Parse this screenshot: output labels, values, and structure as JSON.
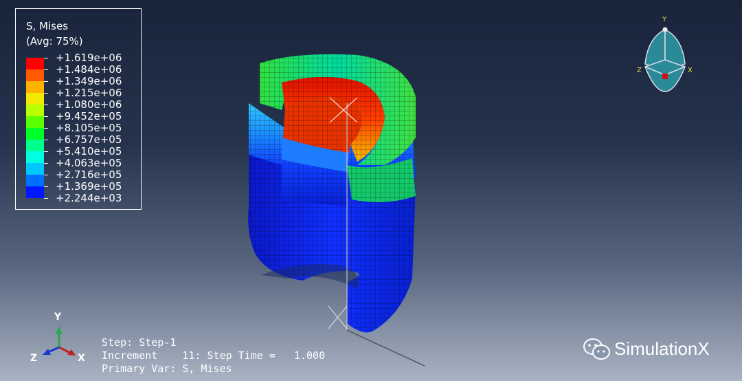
{
  "legend": {
    "title": "S, Mises",
    "subtitle": "(Avg: 75%)",
    "entries": [
      {
        "value": "+1.619e+06",
        "color": "#ff0000"
      },
      {
        "value": "+1.484e+06",
        "color": "#ff5a00"
      },
      {
        "value": "+1.349e+06",
        "color": "#ffb300"
      },
      {
        "value": "+1.215e+06",
        "color": "#f2e800"
      },
      {
        "value": "+1.080e+06",
        "color": "#b8ff00"
      },
      {
        "value": "+9.452e+05",
        "color": "#5aff00"
      },
      {
        "value": "+8.105e+05",
        "color": "#00ff2a"
      },
      {
        "value": "+6.757e+05",
        "color": "#00ff8c"
      },
      {
        "value": "+5.410e+05",
        "color": "#00ffe0"
      },
      {
        "value": "+4.063e+05",
        "color": "#00c8ff"
      },
      {
        "value": "+2.716e+05",
        "color": "#0070ff"
      },
      {
        "value": "+1.369e+05",
        "color": "#0018ff"
      },
      {
        "value": "+2.244e+03",
        "color": null
      }
    ]
  },
  "view_cube": {
    "y_label": "Y",
    "z_label": "Z",
    "x_label": "X"
  },
  "triad": {
    "y_label": "Y",
    "z_label": "Z",
    "x_label": "X"
  },
  "status": {
    "step_label": "Step: Step-1",
    "increment_label": "Increment",
    "increment_value": "11: Step Time =",
    "step_time": "1.000",
    "primary_var": "Primary Var: S, Mises"
  },
  "watermark": {
    "text": "SimulationX",
    "icon": "wechat-icon"
  },
  "colors": {
    "max_stress": "#ff0000",
    "min_stress": "#0018ff",
    "mesh_line": "#000000"
  }
}
